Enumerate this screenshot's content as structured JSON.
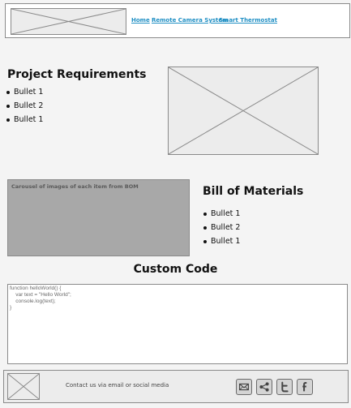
{
  "header": {
    "nav": [
      "Home",
      "Remote Camera System",
      "Smart Thermostat"
    ]
  },
  "requirements": {
    "title": "Project Requirements",
    "bullets": [
      "Bullet 1",
      "Bullet 2",
      "Bullet 1"
    ]
  },
  "bom": {
    "title": "Bill of Materials",
    "bullets": [
      "Bullet 1",
      "Bullet 2",
      "Bullet 1"
    ],
    "carousel_text": "Carousel of  images of each item from BOM"
  },
  "code": {
    "title": "Custom Code",
    "lines": [
      "function helloWorld() {",
      "    var text = \"Hello World\";",
      "    console.log(text);",
      "}"
    ]
  },
  "footer": {
    "contact": "Contact us via email or social media",
    "social_icons": [
      "email-icon",
      "share-icon",
      "twitter-icon",
      "facebook-icon"
    ]
  }
}
